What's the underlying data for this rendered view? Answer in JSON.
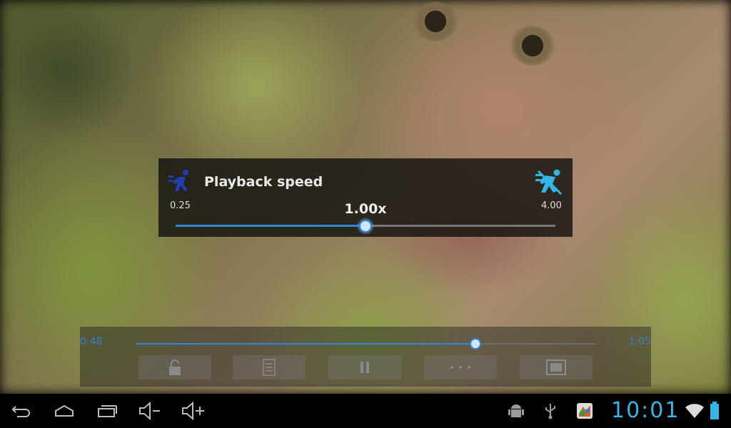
{
  "playback_speed": {
    "title": "Playback speed",
    "min_label": "0.25",
    "max_label": "4.00",
    "value_label": "1.00x",
    "slider_fraction": 0.5
  },
  "player": {
    "current_time": "0:48",
    "total_time": "1:05",
    "progress_fraction": 0.739,
    "buttons": [
      "lock-icon",
      "playlist-icon",
      "pause-icon",
      "more-icon",
      "fullscreen-icon"
    ]
  },
  "status_bar": {
    "clock": "10:01"
  },
  "colors": {
    "accent": "#33b5e5",
    "slider_blue": "#2f86d6",
    "slow_icon": "#1f3fb0"
  }
}
